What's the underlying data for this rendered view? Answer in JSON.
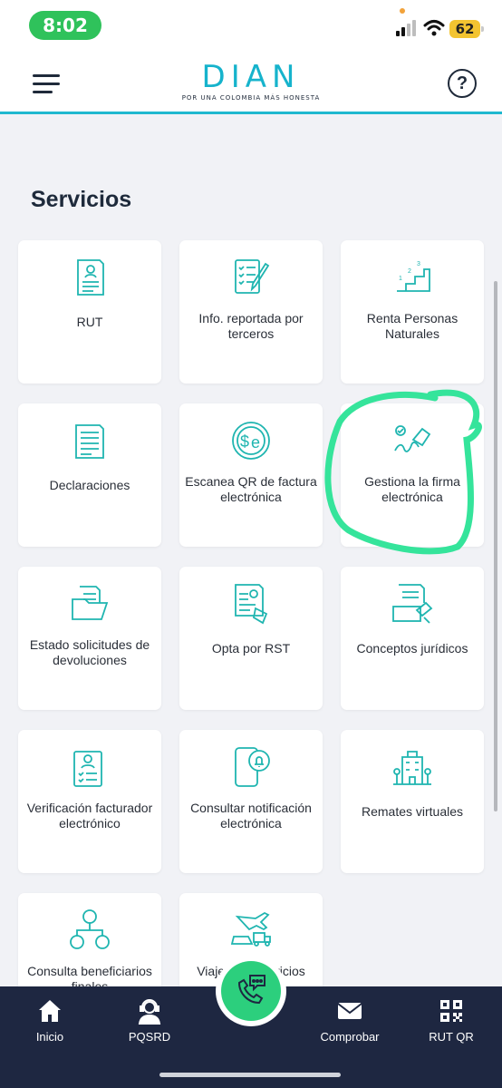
{
  "status_bar": {
    "time": "8:02",
    "battery": "62",
    "colors": {
      "time_pill": "#2fc25b",
      "battery": "#f3c431",
      "privacy_dot": "#f2a23a"
    }
  },
  "header": {
    "logo_text": "DIAN",
    "logo_tagline": "POR UNA COLOMBIA MÁS HONESTA",
    "help_label": "?",
    "colors": {
      "brand": "#16b3cc",
      "dark": "#1f2a3a"
    }
  },
  "section": {
    "title": "Servicios"
  },
  "services": [
    {
      "label": "RUT",
      "icon": "document-user-icon"
    },
    {
      "label": "Info. reportada por terceros",
      "icon": "checklist-pen-icon"
    },
    {
      "label": "Renta Personas Naturales",
      "icon": "stairs-numbers-icon"
    },
    {
      "label": "Declaraciones",
      "icon": "document-lines-icon"
    },
    {
      "label": "Escanea QR de factura electrónica",
      "icon": "dollar-e-coin-icon"
    },
    {
      "label": "Gestiona la firma electrónica",
      "icon": "signature-hand-icon"
    },
    {
      "label": "Estado solicitudes de devoluciones",
      "icon": "folder-icon"
    },
    {
      "label": "Opta por RST",
      "icon": "document-hand-icon"
    },
    {
      "label": "Conceptos jurídicos",
      "icon": "gavel-document-icon"
    },
    {
      "label": "Verificación facturador electrónico",
      "icon": "user-checklist-icon"
    },
    {
      "label": "Consultar notificación electrónica",
      "icon": "phone-bell-icon"
    },
    {
      "label": "Remates virtuales",
      "icon": "building-icon"
    },
    {
      "label": "Consulta beneficiarios finales",
      "icon": "users-hierarchy-icon"
    },
    {
      "label": "Viajeros y servicios",
      "icon": "plane-truck-ship-icon"
    }
  ],
  "bottom_nav": [
    {
      "label": "Inicio",
      "icon": "home-icon"
    },
    {
      "label": "PQSRD",
      "icon": "agent-headset-icon"
    },
    {
      "label": "Comprobar",
      "icon": "envelope-icon"
    },
    {
      "label": "RUT QR",
      "icon": "qr-code-icon"
    }
  ],
  "fab": {
    "icon": "phone-chat-icon",
    "color": "#2ccf7d"
  },
  "colors": {
    "icon_teal": "#1fb5b0",
    "nav_bg": "#1e2741",
    "annotation": "#35e49b",
    "page_bg": "#f1f2f6"
  }
}
